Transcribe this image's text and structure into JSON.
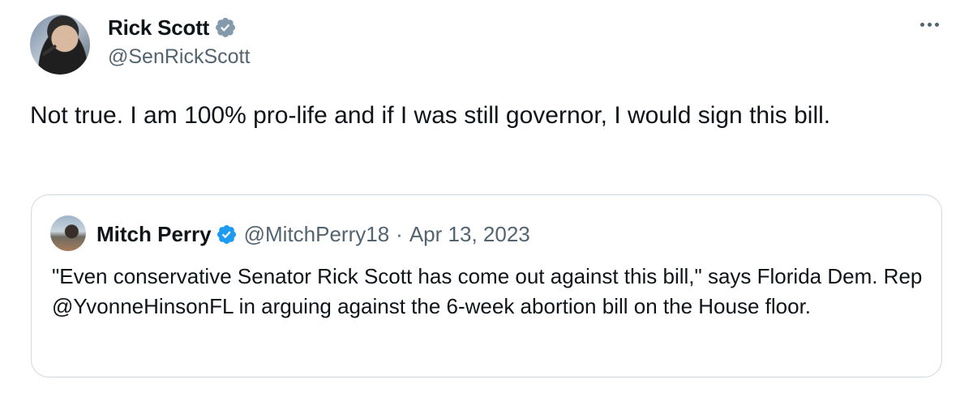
{
  "tweet": {
    "author": {
      "display_name": "Rick Scott",
      "handle": "@SenRickScott",
      "verified": true
    },
    "text": "Not true. I am 100% pro-life and if I was still governor, I would sign this bill.",
    "quoted": {
      "author": {
        "display_name": "Mitch Perry",
        "handle": "@MitchPerry18",
        "verified": true
      },
      "separator": "·",
      "date": "Apr 13, 2023",
      "text": "\"Even conservative Senator Rick Scott has come out against this bill,\" says Florida Dem. Rep @YvonneHinsonFL in arguing against the 6-week abortion bill on the House floor."
    }
  },
  "icons": {
    "verified": "verified-badge-icon",
    "more": "more-options-icon"
  },
  "colors": {
    "verified_main": "#829aab",
    "verified_quote": "#1d9bf0",
    "secondary_text": "#536471",
    "border": "#cfd9de"
  }
}
